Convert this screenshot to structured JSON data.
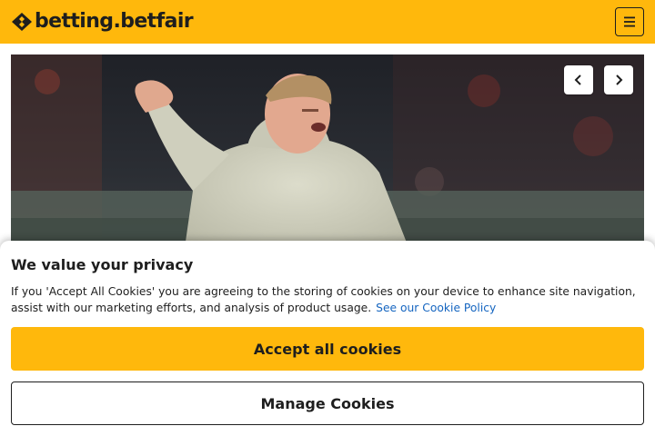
{
  "header": {
    "logo_text": "betting.betfair",
    "menu_icon": "hamburger-icon",
    "background_color": "#ffb80c"
  },
  "hero": {
    "prev_icon": "chevron-left-icon",
    "next_icon": "chevron-right-icon"
  },
  "cookie_banner": {
    "title": "We value your privacy",
    "description": "If you 'Accept All Cookies' you are agreeing to the storing of cookies on your device to enhance site navigation, assist with our marketing efforts, and analysis of product usage.",
    "policy_link": "See our Cookie Policy",
    "policy_link_color": "#1565c0",
    "accept_label": "Accept all cookies",
    "manage_label": "Manage Cookies"
  }
}
